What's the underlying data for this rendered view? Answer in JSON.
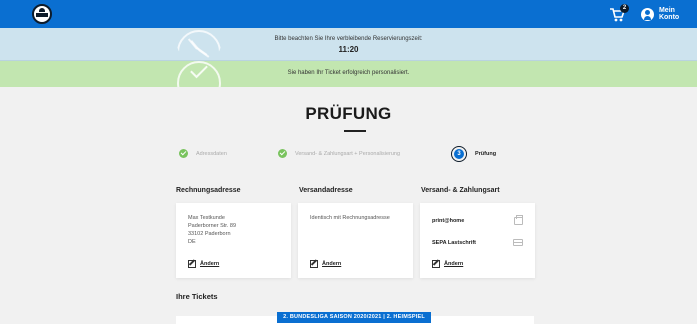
{
  "header": {
    "logo": "club-crest-logo",
    "cart_count": "2",
    "account_label": "Mein Konto"
  },
  "timer_banner": {
    "message": "Bitte beachten Sie Ihre verbleibende Reservierungszeit:",
    "time": "11:20"
  },
  "success_banner": {
    "message": "Sie haben Ihr Ticket erfolgreich personalisiert."
  },
  "page": {
    "title": "PRÜFUNG"
  },
  "steps": [
    {
      "label": "Adressdaten",
      "state": "done"
    },
    {
      "label": "Versand- & Zahlungsart + Personalisierung",
      "state": "done"
    },
    {
      "number": "3",
      "label": "Prüfung",
      "state": "active"
    }
  ],
  "billing": {
    "heading": "Rechnungsadresse",
    "lines": [
      "Max Testkunde",
      "Paderborner Str. 89",
      "33102 Paderborn",
      "DE"
    ],
    "edit_label": "Ändern"
  },
  "shipping": {
    "heading": "Versandadresse",
    "text": "Identisch mit Rechnungsadresse",
    "edit_label": "Ändern"
  },
  "payment": {
    "heading": "Versand- & Zahlungsart",
    "shipping_method": "print@home",
    "payment_method": "SEPA Lastschrift",
    "edit_label": "Ändern"
  },
  "tickets": {
    "heading": "Ihre Tickets",
    "banner": "2. BUNDESLIGA SAISON 2020/2021 | 2. HEIMSPIEL"
  },
  "colors": {
    "topbar": "#0a6fd1",
    "timer_bg": "#cde3ee",
    "success_bg": "#c2e6b0",
    "step_done": "#79c35e"
  }
}
